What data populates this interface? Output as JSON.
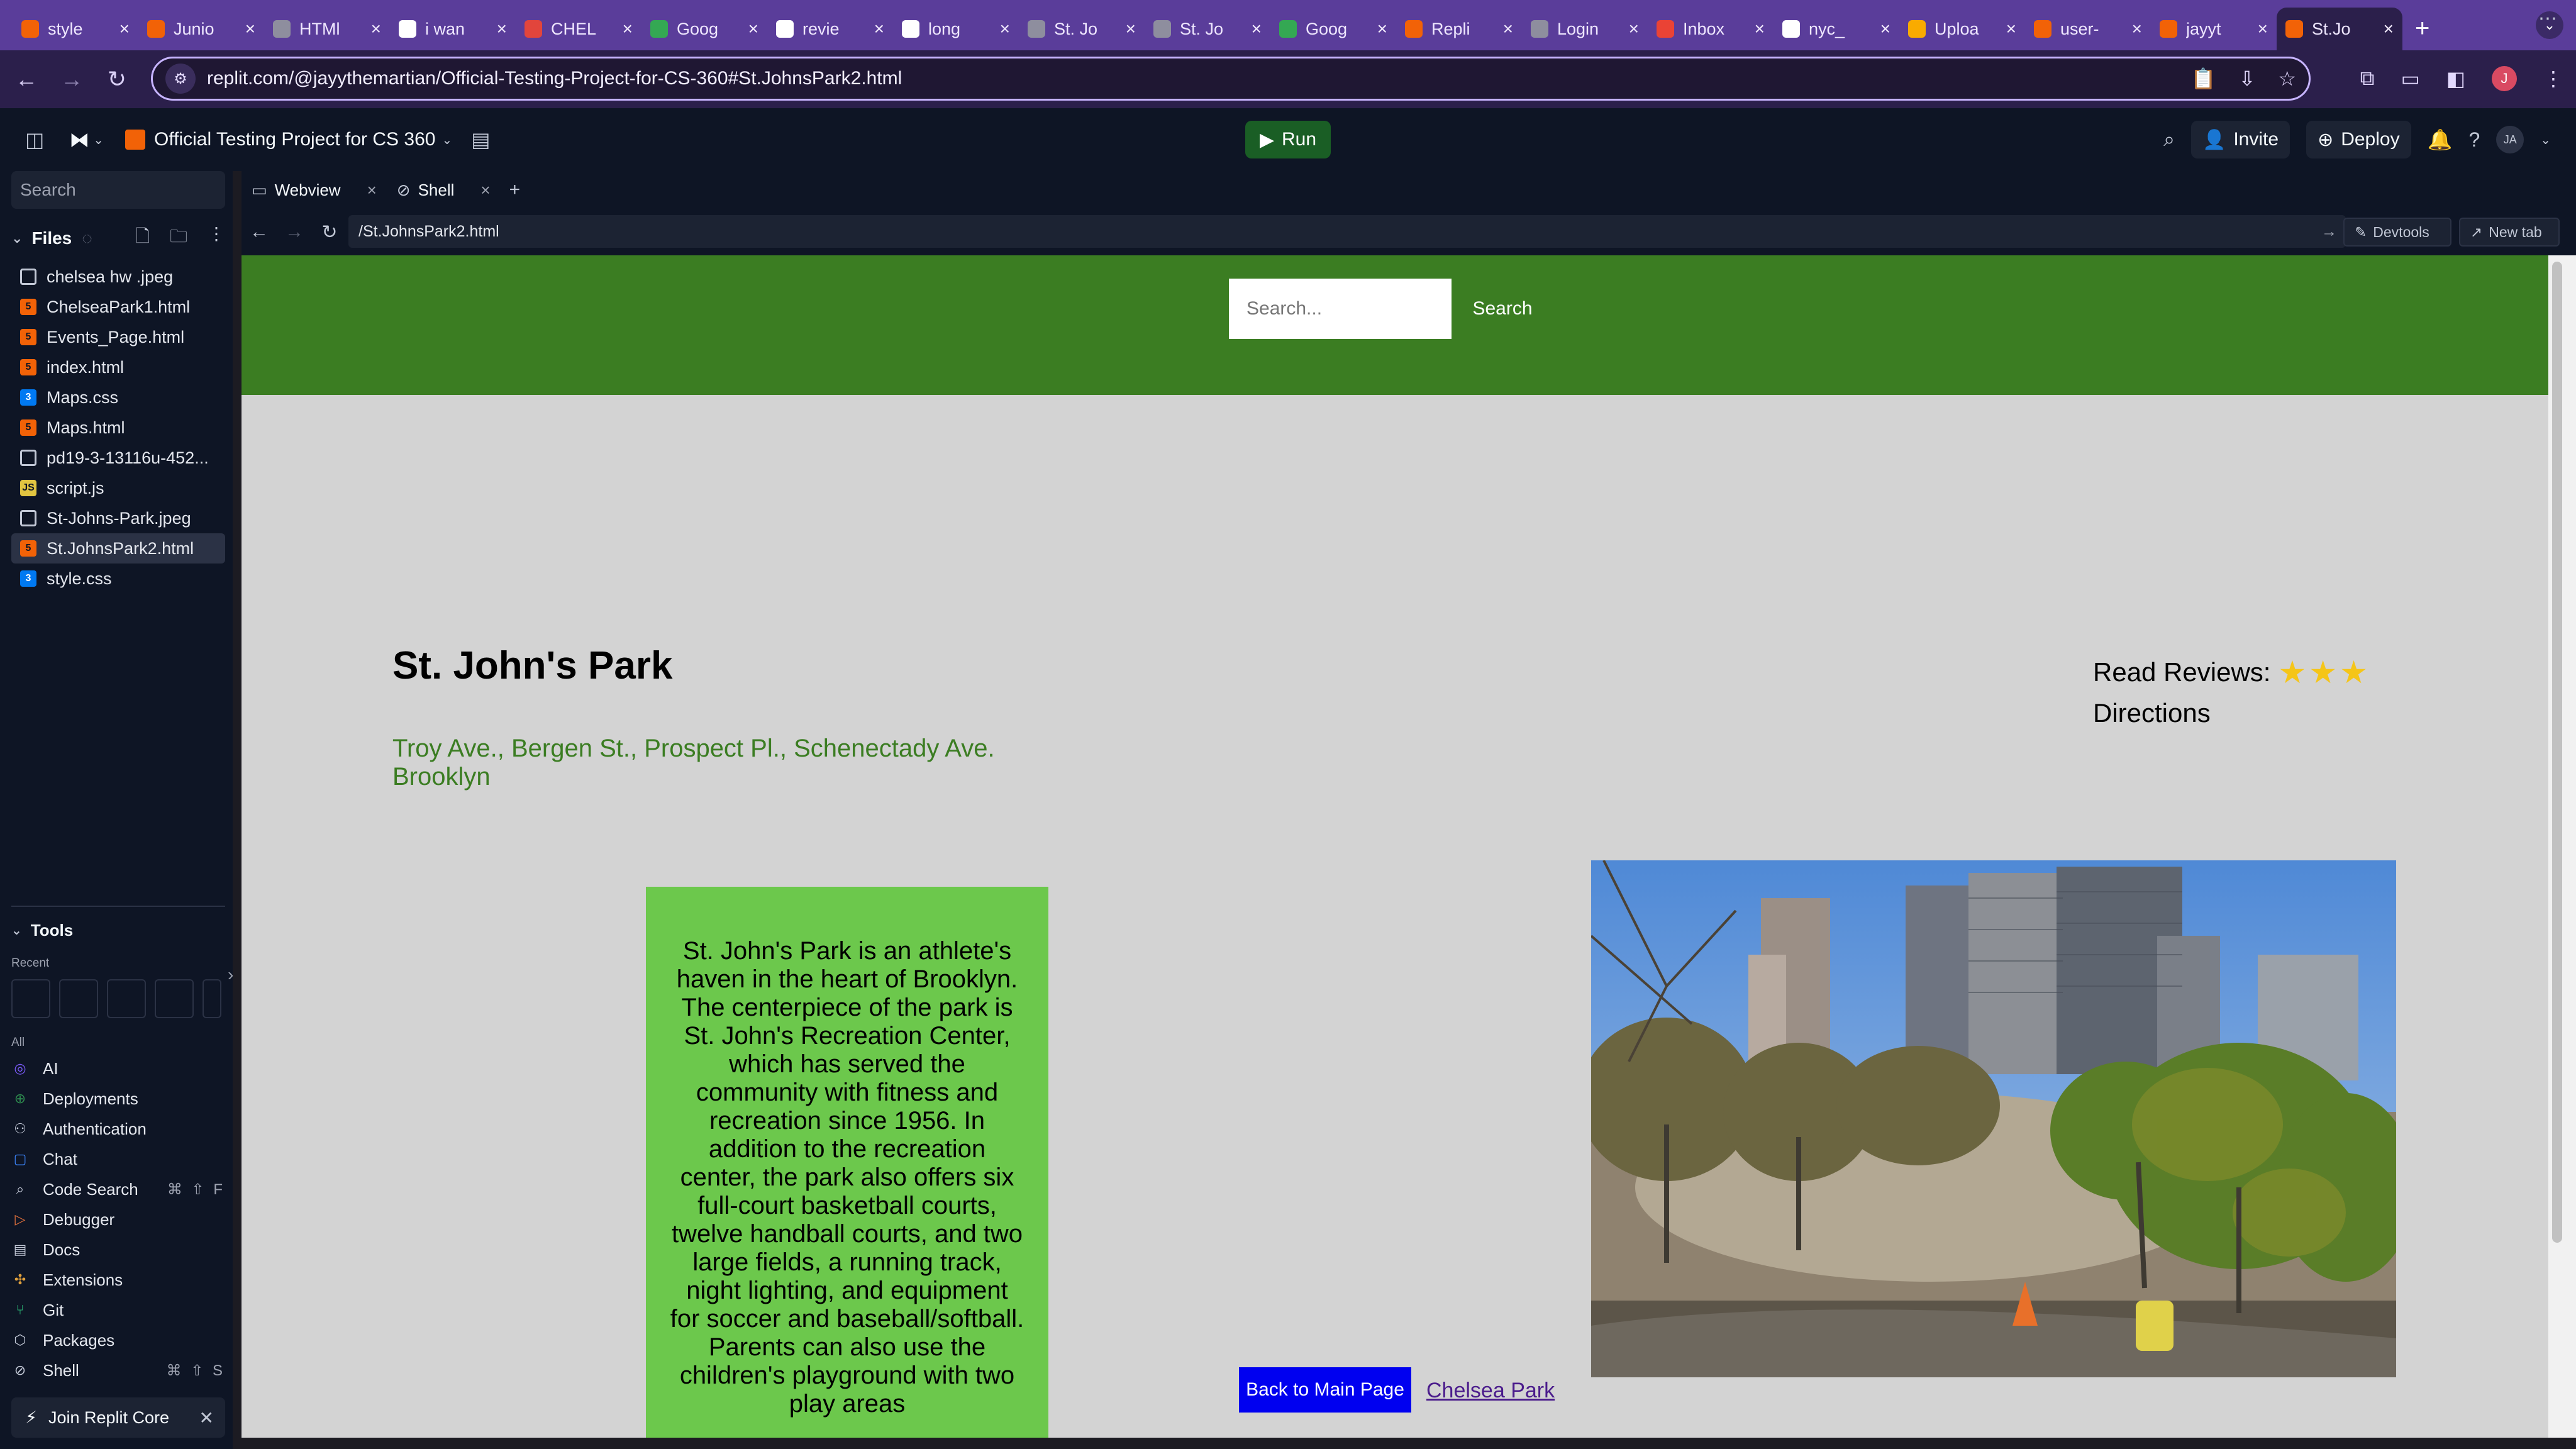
{
  "browser": {
    "tabs": [
      {
        "title": "style",
        "icon": "replit-icon",
        "color": "#f26207"
      },
      {
        "title": "Junio",
        "icon": "replit-icon",
        "color": "#f26207"
      },
      {
        "title": "HTMl",
        "icon": "globe-icon",
        "color": "#8e8e9e"
      },
      {
        "title": "i wan",
        "icon": "google-icon",
        "color": "#ffffff"
      },
      {
        "title": "CHEL",
        "icon": "nyc-parks-icon",
        "color": "#e2453c"
      },
      {
        "title": "Goog",
        "icon": "maps-icon",
        "color": "#34a853"
      },
      {
        "title": "revie",
        "icon": "google-icon",
        "color": "#ffffff"
      },
      {
        "title": "long",
        "icon": "google-icon",
        "color": "#ffffff"
      },
      {
        "title": "St. Jo",
        "icon": "globe-icon",
        "color": "#8e8e9e"
      },
      {
        "title": "St. Jo",
        "icon": "globe-icon",
        "color": "#8e8e9e"
      },
      {
        "title": "Goog",
        "icon": "maps-icon",
        "color": "#34a853"
      },
      {
        "title": "Repli",
        "icon": "replit-icon",
        "color": "#f26207"
      },
      {
        "title": "Login",
        "icon": "globe-icon",
        "color": "#8e8e9e"
      },
      {
        "title": "Inbox",
        "icon": "gmail-icon",
        "color": "#ea4335"
      },
      {
        "title": "nyc_",
        "icon": "github-icon",
        "color": "#ffffff"
      },
      {
        "title": "Uploa",
        "icon": "chart-icon",
        "color": "#f9ab00"
      },
      {
        "title": "user-",
        "icon": "replit-icon",
        "color": "#f26207"
      },
      {
        "title": "jayyt",
        "icon": "replit-icon",
        "color": "#f26207"
      },
      {
        "title": "St.Jo",
        "icon": "replit-icon",
        "color": "#f26207",
        "active": true
      }
    ],
    "url": "replit.com/@jayythemartian/Official-Testing-Project-for-CS-360#St.JohnsPark2.html",
    "profile_initial": "J"
  },
  "replit": {
    "project_name": "Official Testing Project for CS 360",
    "run_label": "Run",
    "invite_label": "Invite",
    "deploy_label": "Deploy",
    "user_initials": "JA"
  },
  "sidebar": {
    "search_placeholder": "Search",
    "files_label": "Files",
    "files": [
      {
        "name": "chelsea hw .jpeg",
        "type": "img"
      },
      {
        "name": "ChelseaPark1.html",
        "type": "html"
      },
      {
        "name": "Events_Page.html",
        "type": "html"
      },
      {
        "name": "index.html",
        "type": "html"
      },
      {
        "name": "Maps.css",
        "type": "css"
      },
      {
        "name": "Maps.html",
        "type": "html"
      },
      {
        "name": "pd19-3-13116u-452...",
        "type": "img"
      },
      {
        "name": "script.js",
        "type": "js"
      },
      {
        "name": "St-Johns-Park.jpeg",
        "type": "img"
      },
      {
        "name": "St.JohnsPark2.html",
        "type": "html",
        "selected": true
      },
      {
        "name": "style.css",
        "type": "css"
      }
    ],
    "tools_label": "Tools",
    "recent_label": "Recent",
    "all_label": "All",
    "tools": [
      {
        "name": "AI",
        "icon": "ai-icon",
        "shortcut": ""
      },
      {
        "name": "Deployments",
        "icon": "deployments-icon",
        "shortcut": ""
      },
      {
        "name": "Authentication",
        "icon": "user-icon",
        "shortcut": ""
      },
      {
        "name": "Chat",
        "icon": "chat-icon",
        "shortcut": ""
      },
      {
        "name": "Code Search",
        "icon": "search-icon",
        "shortcut": "⌘ ⇧ F"
      },
      {
        "name": "Debugger",
        "icon": "debugger-icon",
        "shortcut": ""
      },
      {
        "name": "Docs",
        "icon": "docs-icon",
        "shortcut": ""
      },
      {
        "name": "Extensions",
        "icon": "extensions-icon",
        "shortcut": ""
      },
      {
        "name": "Git",
        "icon": "git-icon",
        "shortcut": ""
      },
      {
        "name": "Packages",
        "icon": "packages-icon",
        "shortcut": ""
      },
      {
        "name": "Shell",
        "icon": "shell-icon",
        "shortcut": "⌘ ⇧ S"
      }
    ],
    "join_core_label": "Join Replit Core"
  },
  "pane": {
    "tabs": [
      {
        "label": "Webview",
        "icon": "webview-icon"
      },
      {
        "label": "Shell",
        "icon": "shell-icon"
      }
    ],
    "webview_url": "/St.JohnsPark2.html",
    "devtools_label": "Devtools",
    "new_tab_label": "New tab"
  },
  "site": {
    "search_placeholder": "Search...",
    "search_button": "Search",
    "title": "St. John's Park",
    "address": "Troy Ave., Bergen St., Prospect Pl., Schenectady Ave. Brooklyn",
    "reviews_label": "Read Reviews:",
    "stars": "★★★",
    "rating": 3,
    "directions_label": "Directions",
    "description": "St. John's Park is an athlete's haven in the heart of Brooklyn. The centerpiece of the park is St. John's Recreation Center, which has served the community with fitness and recreation since 1956. In addition to the recreation center, the park also offers six full-court basketball courts, twelve handball courts, and two large fields, a running track, night lighting, and equipment for soccer and baseball/softball. Parents can also use the children's playground with two play areas",
    "back_button": "Back to Main Page",
    "chelsea_link": " Chelsea Park",
    "colors": {
      "header_green": "#3b7d22",
      "desc_green": "#6cc84c",
      "back_blue": "#0000f0"
    }
  }
}
